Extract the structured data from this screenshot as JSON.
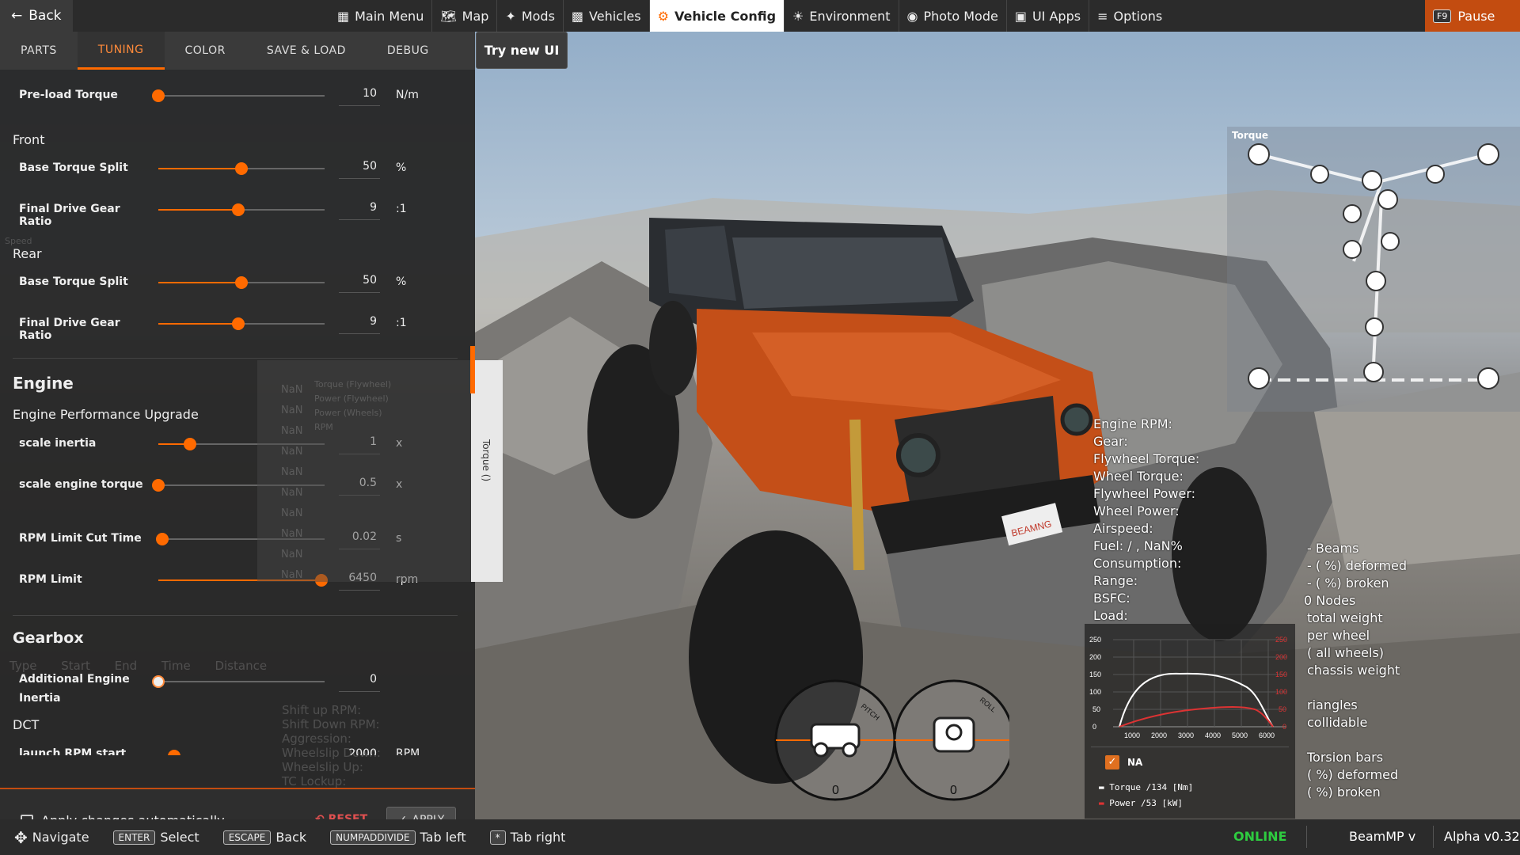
{
  "topbar": {
    "back_label": "Back",
    "nav": [
      {
        "label": "Main Menu",
        "icon": "grid-icon"
      },
      {
        "label": "Map",
        "icon": "map-icon"
      },
      {
        "label": "Mods",
        "icon": "puzzle-icon"
      },
      {
        "label": "Vehicles",
        "icon": "car-icon"
      },
      {
        "label": "Vehicle Config",
        "icon": "engine-icon",
        "active": true
      },
      {
        "label": "Environment",
        "icon": "sun-cloud-icon"
      },
      {
        "label": "Photo Mode",
        "icon": "camera-icon"
      },
      {
        "label": "UI Apps",
        "icon": "apps-icon"
      },
      {
        "label": "Options",
        "icon": "sliders-icon"
      }
    ],
    "pause_key": "F9",
    "pause_label": "Pause",
    "accent": "#ff6a00"
  },
  "tabs": [
    "PARTS",
    "TUNING",
    "COLOR",
    "SAVE & LOAD",
    "DEBUG"
  ],
  "active_tab": "TUNING",
  "try_new_ui": "Try new UI",
  "tuning": {
    "preload": {
      "label": "Pre-load Torque",
      "value": "10",
      "unit": "N/m",
      "level": 0.0
    },
    "front_header": "Front",
    "front_split": {
      "label": "Base Torque Split",
      "value": "50",
      "unit": "%",
      "level": 0.5
    },
    "front_ratio": {
      "label": "Final Drive Gear Ratio",
      "value": "9",
      "unit": ":1",
      "level": 0.48
    },
    "rear_header": "Rear",
    "rear_split": {
      "label": "Base Torque Split",
      "value": "50",
      "unit": "%",
      "level": 0.5
    },
    "rear_ratio": {
      "label": "Final Drive Gear Ratio",
      "value": "9",
      "unit": ":1",
      "level": 0.48
    },
    "engine_header": "Engine",
    "engine_sub": "Engine Performance Upgrade",
    "scale_inertia": {
      "label": "scale inertia",
      "value": "1",
      "unit": "x",
      "level": 0.19
    },
    "scale_torque": {
      "label": "scale engine torque",
      "value": "0.5",
      "unit": "x",
      "level": 0.0
    },
    "rpm_cut": {
      "label": "RPM Limit Cut Time",
      "value": "0.02",
      "unit": "s",
      "level": 0.02
    },
    "rpm_limit": {
      "label": "RPM Limit",
      "value": "6450",
      "unit": "rpm",
      "level": 1.0
    },
    "gearbox_header": "Gearbox",
    "add_inertia": {
      "label1": "Additional Engine",
      "label2": "Inertia",
      "value": "0",
      "level": 0.0
    },
    "dct_header": "DCT",
    "launch_rpm": {
      "label": "launch RPM start",
      "value": "2000",
      "unit": "RPM"
    }
  },
  "apply_bar": {
    "auto_label": "Apply changes automatically",
    "reset_label": "RESET",
    "apply_label": "APPLY"
  },
  "ghost": {
    "speed": "Speed",
    "nan": "NaN",
    "legend": [
      "Torque (Flywheel)",
      "Power (Flywheel)",
      "Power (Wheels)",
      "RPM"
    ],
    "table_head": [
      "Type",
      "Start",
      "End",
      "Time",
      "Distance"
    ],
    "shift": [
      "Shift up RPM:",
      "Shift Down RPM:",
      "Aggression:",
      "Wheelslip Down:",
      "Wheelslip Up:",
      "TC Lockup:"
    ],
    "torque_tab": "Torque ()"
  },
  "hud": {
    "engine_lines": [
      "Engine RPM:",
      "Gear:",
      "Flywheel Torque:",
      "Wheel Torque:",
      "Flywheel Power:",
      "Wheel Power:",
      "Airspeed:",
      "Fuel: / , NaN%",
      "Consumption:",
      "Range:",
      "BSFC:",
      "Load:"
    ],
    "beam_lines": [
      "- Beams",
      "- ( %) deformed",
      "- ( %) broken",
      "0 Nodes",
      "total weight",
      "per wheel",
      "( all wheels)",
      "chassis weight",
      "",
      "riangles",
      "collidable",
      "",
      "Torsion bars",
      "( %) deformed",
      "( %) broken"
    ],
    "powertrain_title": "Torque",
    "graph": {
      "na_label": "NA",
      "torque_legend": "Torque /134 [Nm]",
      "power_legend": "Power /53 [kW]",
      "x_ticks": [
        "1000",
        "2000",
        "3000",
        "4000",
        "5000",
        "6000"
      ],
      "y_ticks": [
        "0",
        "50",
        "100",
        "150",
        "200",
        "250"
      ],
      "y2_ticks": [
        "0",
        "50",
        "100",
        "150",
        "200",
        "250"
      ]
    },
    "pitch_value": "0",
    "roll_value": "0",
    "pitch_label": "PITCH",
    "roll_label": "ROLL",
    "plate": "BEAMNG"
  },
  "bottombar": {
    "hints": [
      {
        "key": "",
        "label": "Navigate",
        "icon": "dpad-icon"
      },
      {
        "key": "ENTER",
        "label": "Select"
      },
      {
        "key": "ESCAPE",
        "label": "Back"
      },
      {
        "key": "NUMPADDIVIDE",
        "label": "Tab left"
      },
      {
        "key": "*",
        "label": "Tab right"
      }
    ],
    "online": "ONLINE",
    "beammp": "BeamMP v",
    "version": "Alpha v0.32",
    "online_color": "#2ecc40"
  }
}
